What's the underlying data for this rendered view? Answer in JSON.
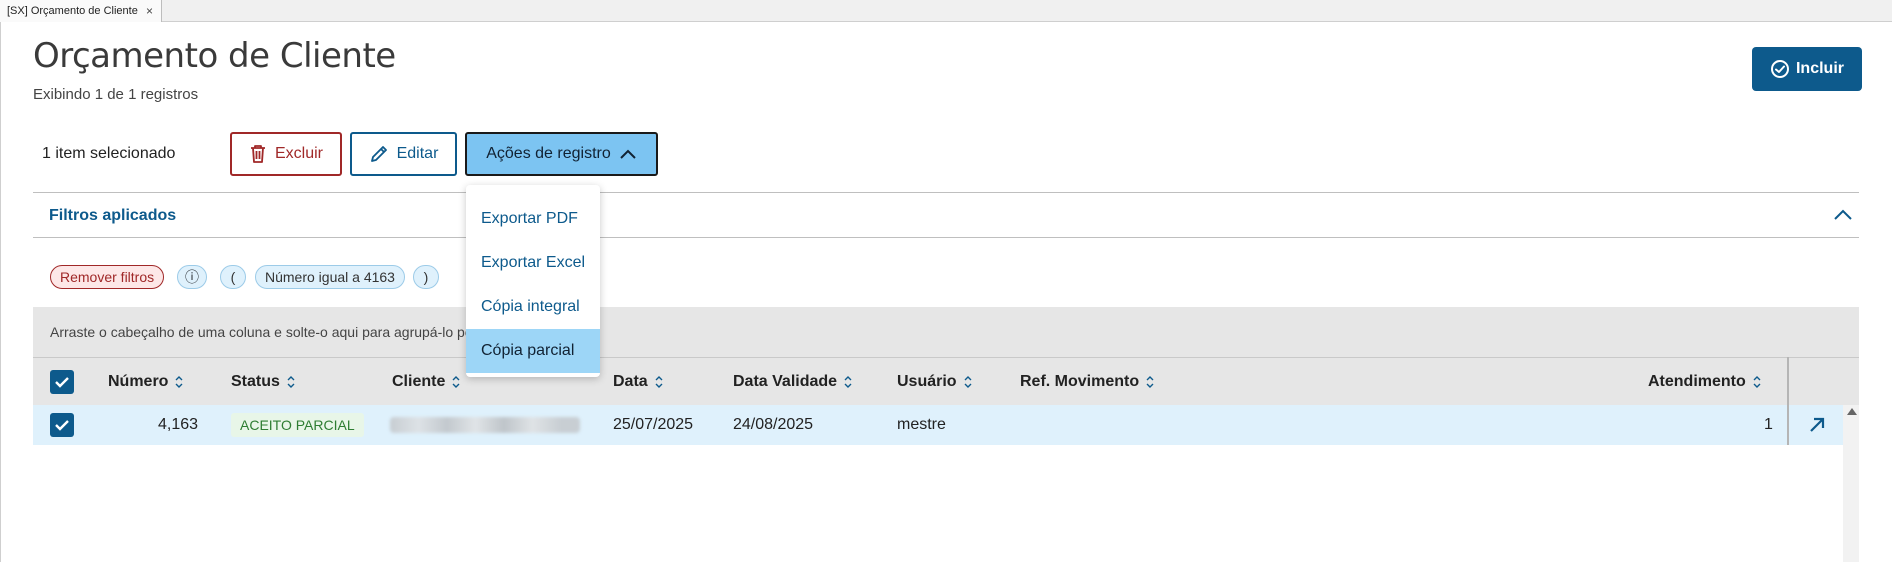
{
  "tab": {
    "title": "[SX] Orçamento de Cliente",
    "close": "×"
  },
  "page": {
    "title": "Orçamento de Cliente",
    "subtitle": "Exibindo 1 de 1 registros"
  },
  "actions": {
    "incluir_label": "Incluir",
    "selected_text": "1 item selecionado",
    "excluir_label": "Excluir",
    "editar_label": "Editar",
    "acoes_label": "Ações de registro"
  },
  "dropdown": {
    "items": [
      "Exportar PDF",
      "Exportar Excel",
      "Cópia integral",
      "Cópia parcial"
    ],
    "active_index": 3
  },
  "filters": {
    "title": "Filtros aplicados",
    "remove_label": "Remover filtros",
    "info_icon": "ⓘ",
    "open_paren": "(",
    "condition": "Número igual a 4163",
    "close_paren": ")"
  },
  "grid": {
    "group_hint": "Arraste o cabeçalho de uma coluna e solte-o aqui para agrupá-lo por essa coluna",
    "columns": [
      "Número",
      "Status",
      "Cliente",
      "Data",
      "Data Validade",
      "Usuário",
      "Ref. Movimento",
      "Atendimento"
    ],
    "rows": [
      {
        "numero": "4,163",
        "status": "ACEITO PARCIAL",
        "cliente": "",
        "data": "25/07/2025",
        "data_validade": "24/08/2025",
        "usuario": "mestre",
        "ref_movimento": "",
        "atendimento": "1"
      }
    ]
  },
  "colors": {
    "primary": "#0d5a8c",
    "danger": "#a02828",
    "selected_row": "#dff1fc",
    "active_button": "#7cc4f2",
    "status_green": "#2e7d32"
  }
}
